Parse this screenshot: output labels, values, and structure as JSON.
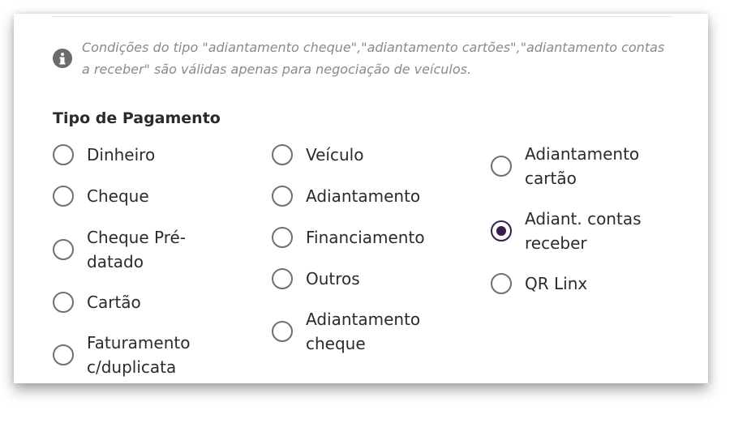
{
  "notice": {
    "icon": "info-icon",
    "text": "Condições do tipo \"adiantamento cheque\",\"adiantamento cartões\",\"adiantamento contas a receber\" são válidas apenas para negociação de veículos."
  },
  "payment": {
    "title": "Tipo de Pagamento",
    "options": [
      {
        "label": "Dinheiro",
        "checked": false
      },
      {
        "label": "Cheque",
        "checked": false
      },
      {
        "label": "Cheque Pré-datado",
        "checked": false
      },
      {
        "label": "Cartão",
        "checked": false
      },
      {
        "label": "Faturamento c/duplicata",
        "checked": false
      },
      {
        "label": "Veículo",
        "checked": false
      },
      {
        "label": "Adiantamento",
        "checked": false
      },
      {
        "label": "Financiamento",
        "checked": false
      },
      {
        "label": "Outros",
        "checked": false
      },
      {
        "label": "Adiantamento cheque",
        "checked": false
      },
      {
        "label": "Adiantamento cartão",
        "checked": false
      },
      {
        "label": "Adiant. contas receber",
        "checked": true
      },
      {
        "label": "QR Linx",
        "checked": false
      }
    ]
  },
  "colors": {
    "accent": "#3b1c4e",
    "radio_border": "#707070",
    "notice_text": "#8a8a8a"
  }
}
